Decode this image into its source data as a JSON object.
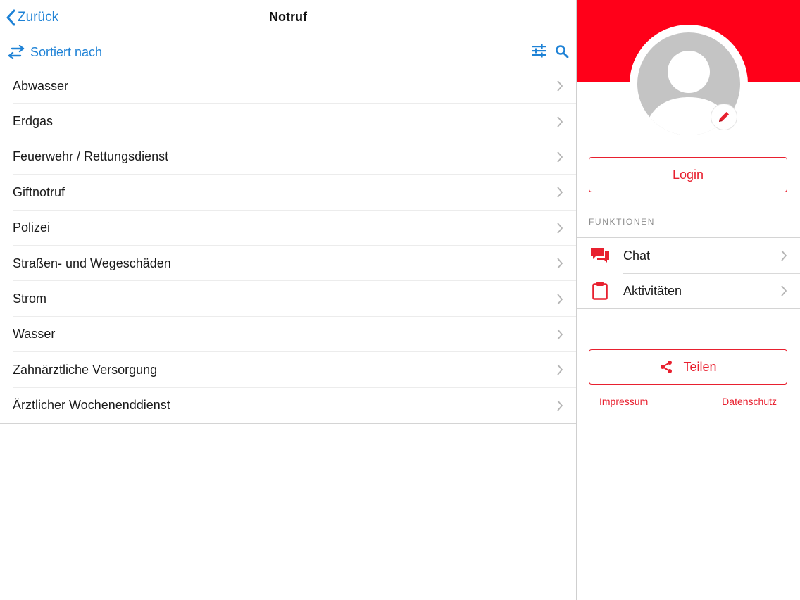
{
  "nav": {
    "back_label": "Zurück",
    "title": "Notruf"
  },
  "sortbar": {
    "sort_label": "Sortiert nach"
  },
  "list": {
    "items": [
      "Abwasser",
      "Erdgas",
      "Feuerwehr / Rettungsdienst",
      "Giftnotruf",
      "Polizei",
      "Straßen- und Wegeschäden",
      "Strom",
      "Wasser",
      "Zahnärztliche Versorgung",
      "Ärztlicher Wochenenddienst"
    ]
  },
  "profile": {
    "login_label": "Login"
  },
  "functions": {
    "section_label": "FUNKTIONEN",
    "items": [
      {
        "label": "Chat",
        "icon": "chat-icon"
      },
      {
        "label": "Aktivitäten",
        "icon": "clipboard-icon"
      }
    ]
  },
  "share": {
    "label": "Teilen"
  },
  "footer": {
    "impressum": "Impressum",
    "datenschutz": "Datenschutz"
  },
  "colors": {
    "accent_blue": "#1e82d6",
    "brand_red": "#ff0019",
    "button_red": "#e8202f",
    "avatar_gray": "#c4c4c4"
  }
}
